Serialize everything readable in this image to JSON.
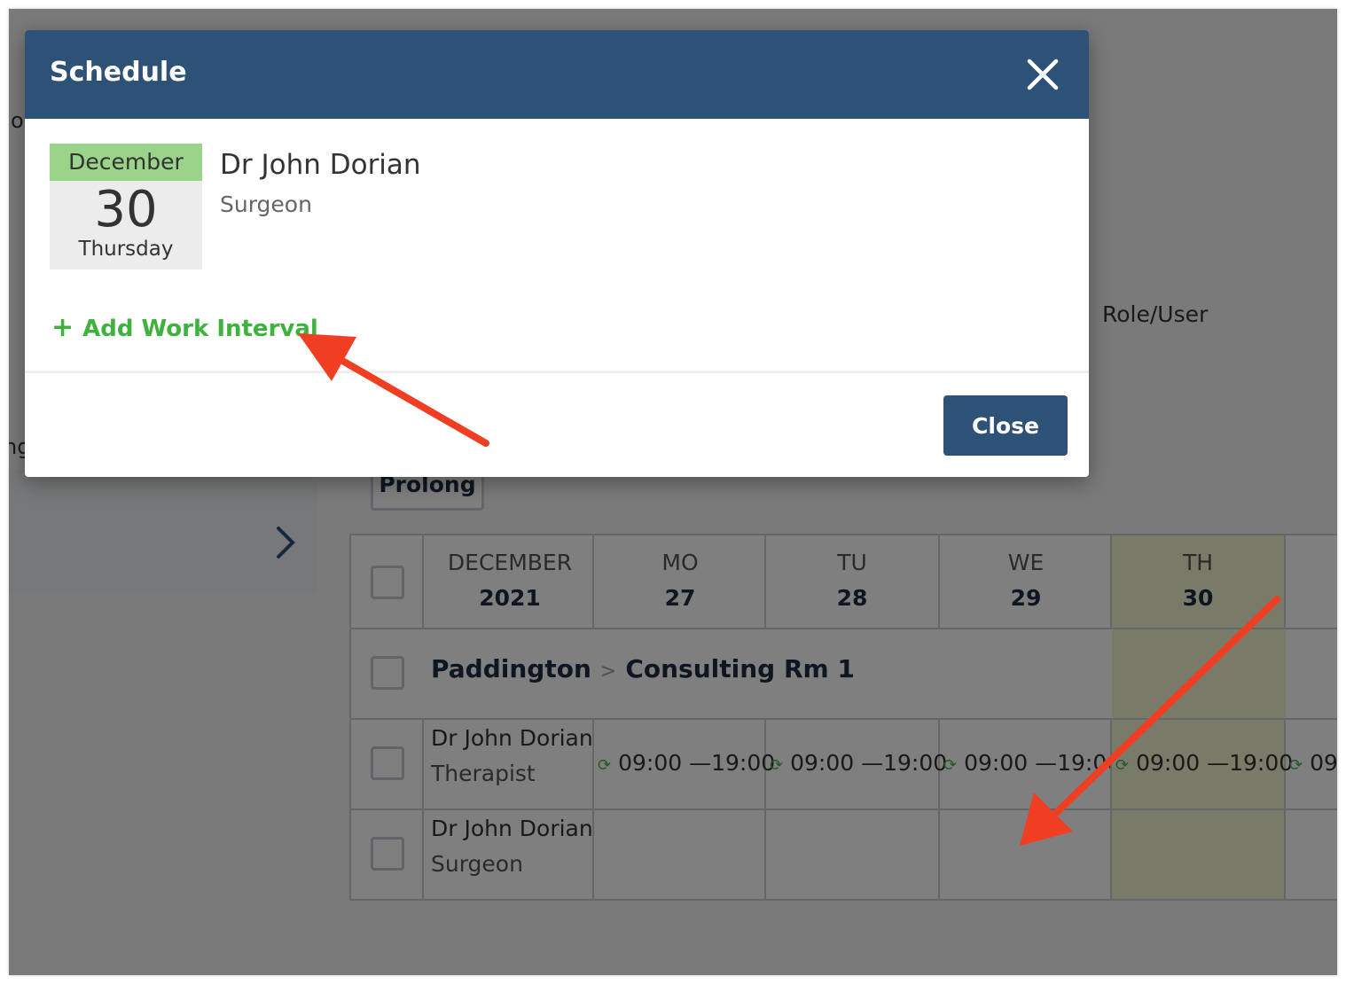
{
  "background": {
    "cut_text_1": "o",
    "cut_text_2": "ng",
    "role_user_label": "Role/User",
    "prolong_label": "Prolong",
    "grid": {
      "header": {
        "month": "DECEMBER",
        "year": "2021",
        "days": [
          {
            "name": "MO",
            "num": "27"
          },
          {
            "name": "TU",
            "num": "28"
          },
          {
            "name": "WE",
            "num": "29"
          },
          {
            "name": "TH",
            "num": "30"
          }
        ]
      },
      "location": {
        "site": "Paddington",
        "room": "Consulting Rm 1"
      },
      "rows": [
        {
          "name": "Dr John Dorian",
          "role": "Therapist",
          "intervals": [
            "09:00 —19:00",
            "09:00 —19:00",
            "09:00 —19:00",
            "09:00 —19:00",
            "09"
          ]
        },
        {
          "name": "Dr John Dorian",
          "role": "Surgeon",
          "intervals": []
        }
      ]
    }
  },
  "modal": {
    "title": "Schedule",
    "date": {
      "month": "December",
      "day": "30",
      "weekday": "Thursday"
    },
    "person": {
      "name": "Dr John Dorian",
      "role": "Surgeon"
    },
    "add_interval_label": "Add Work Interval",
    "close_label": "Close"
  },
  "colors": {
    "header_bg": "#2e5177",
    "accent_green": "#3db23d",
    "date_month_bg": "#9ad38a",
    "annotation_arrow": "#f03e23",
    "today_column": "#f4f5d2"
  }
}
